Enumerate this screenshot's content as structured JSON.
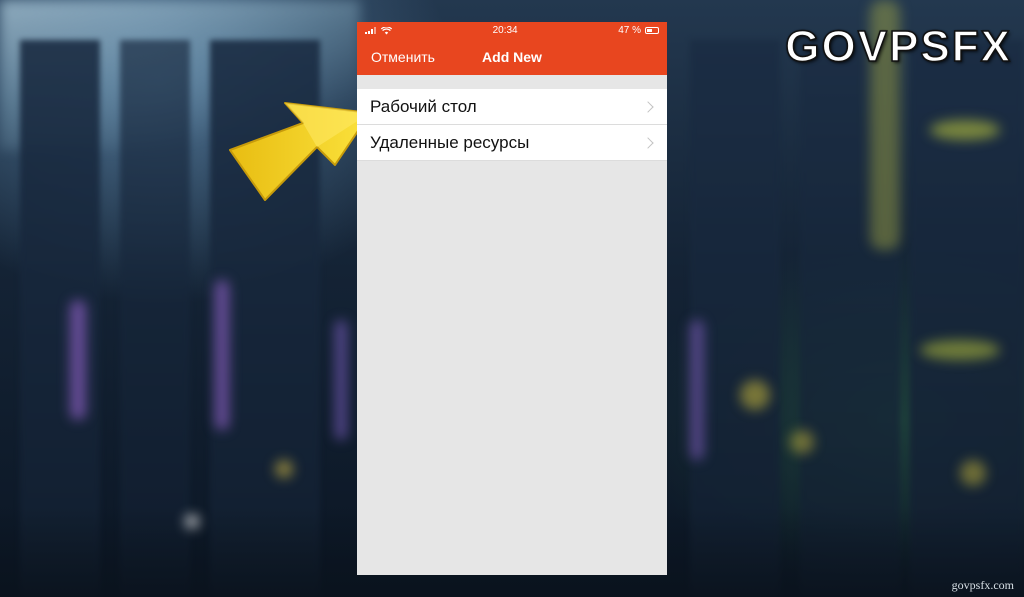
{
  "status_bar": {
    "time": "20:34",
    "battery_text": "47 %",
    "battery_level": 0.47
  },
  "nav": {
    "cancel_label": "Отменить",
    "title": "Add New"
  },
  "list": {
    "items": [
      {
        "label": "Рабочий стол",
        "icon": "chevron-right-icon"
      },
      {
        "label": "Удаленные ресурсы",
        "icon": "chevron-right-icon"
      }
    ]
  },
  "watermark": {
    "logo_text": "GOVPSFX",
    "url": "govpsfx.com"
  },
  "colors": {
    "accent": "#e8461f",
    "arrow": "#f5d31c",
    "screen_bg": "#e6e6e6"
  }
}
